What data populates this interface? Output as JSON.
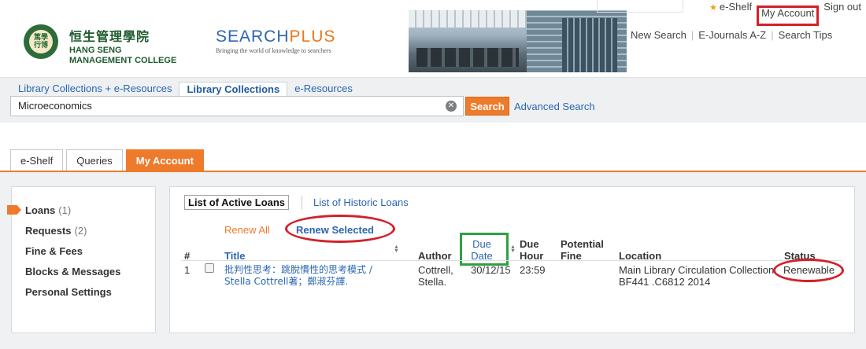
{
  "header": {
    "logo_zh": "恒生管理學院",
    "logo_en_line1": "HANG SENG",
    "logo_en_line2": "MANAGEMENT COLLEGE",
    "emblem_text": "篤學 行博",
    "brand_search": "SEARCH",
    "brand_plus": "PLUS",
    "brand_tagline": "Bringing the world of knowledge to searchers",
    "top_links": {
      "eshelf": "e-Shelf",
      "my_account": "My Account",
      "sign_out": "Sign out"
    },
    "nav_links": [
      "New Search",
      "E-Journals A-Z",
      "Search Tips"
    ]
  },
  "search": {
    "scope_tabs": [
      "Library Collections + e-Resources",
      "Library Collections",
      "e-Resources"
    ],
    "active_scope": "Library Collections",
    "query": "Microeconomics",
    "button_label": "Search",
    "advanced_label": "Advanced Search"
  },
  "main_tabs": [
    "e-Shelf",
    "Queries",
    "My Account"
  ],
  "sidebar": {
    "items": [
      {
        "label": "Loans",
        "count": "(1)"
      },
      {
        "label": "Requests",
        "count": "(2)"
      },
      {
        "label": "Fine & Fees",
        "count": ""
      },
      {
        "label": "Blocks & Messages",
        "count": ""
      },
      {
        "label": "Personal Settings",
        "count": ""
      }
    ]
  },
  "loans": {
    "tab_active": "List of Active Loans",
    "tab_history": "List of Historic Loans",
    "renew_all": "Renew All",
    "renew_selected": "Renew Selected",
    "columns": {
      "num": "#",
      "title": "Title",
      "author": "Author",
      "due_date_1": "Due",
      "due_date_2": "Date",
      "due_hour_1": "Due",
      "due_hour_2": "Hour",
      "fine_1": "Potential",
      "fine_2": "Fine",
      "location": "Location",
      "status": "Status"
    },
    "rows": [
      {
        "num": "1",
        "title_1": "批判性思考：跳脫慣性的思考模式 /",
        "title_2": "Stella Cottrell著；鄭淑芬譯.",
        "author_1": "Cottrell,",
        "author_2": "Stella.",
        "due_date": "30/12/15",
        "due_hour": "23:59",
        "location_1": "Main Library Circulation Collection",
        "location_2": "BF441 .C6812 2014",
        "status": "Renewable"
      }
    ]
  },
  "colors": {
    "accent_orange": "#ee7b2c",
    "link_blue": "#2b66b0",
    "annotation_red": "#d3202a",
    "annotation_green": "#2ea043"
  }
}
